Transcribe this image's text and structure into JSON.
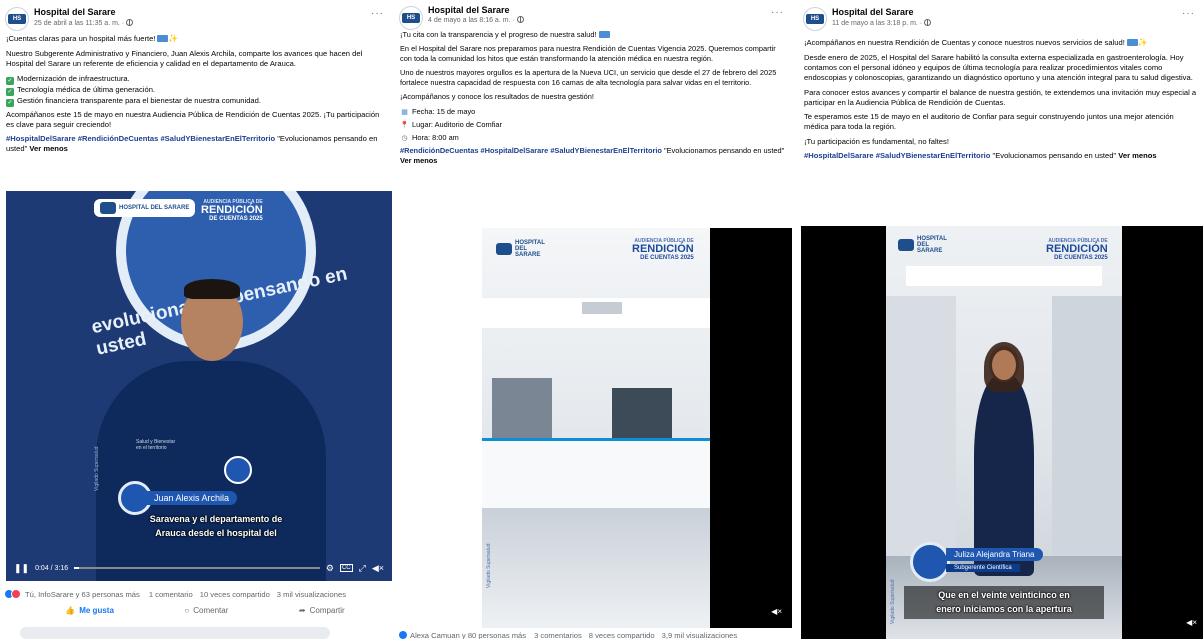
{
  "colors": {
    "link_blue": "#1d3f8f",
    "like_blue": "#1877f2",
    "meta_gray": "#65676b",
    "brand_blue": "#1f4e8c",
    "check_green": "#3aa55c"
  },
  "icons": [
    "globe-icon",
    "more-options-icon",
    "check-icon",
    "calendar-icon",
    "pin-icon",
    "clock-icon",
    "play-pause-icon",
    "settings-icon",
    "cc-icon",
    "expand-icon",
    "volume-icon",
    "like-icon",
    "comment-icon",
    "share-icon"
  ],
  "posts": [
    {
      "page_name": "Hospital del Sarare",
      "date": "25 de abril a las 11:35 a. m. ·",
      "text": {
        "intro": "¡Cuentas claras para un hospital más fuerte!",
        "p1": "Nuestro Subgerente Administrativo y Financiero, Juan Alexis Archila, comparte los avances que hacen del Hospital del Sarare un referente de eficiencia y calidad en el departamento de Arauca.",
        "bullets": [
          "Modernización de infraestructura.",
          "Tecnología médica de última generación.",
          "Gestión financiera transparente para el bienestar de nuestra comunidad."
        ],
        "p2": "Acompáñanos este 15 de mayo en nuestra Audiencia Pública de Rendición de Cuentas 2025. ¡Tu participación es clave para seguir creciendo!",
        "hashtags": "#HospitalDelSarare #RendiciónDeCuentas #SaludYBienestarEnElTerritorio",
        "tagline": " \"Evolucionamos pensando en usted\" ",
        "ver_menos": "Ver menos"
      },
      "video": {
        "bg_text": "evolucionamos pensando en usted",
        "logo_text": "HOSPITAL DEL SARARE",
        "wm_top": "AUDIENCIA PÚBLICA DE",
        "wm_main": "RENDICIÓN",
        "wm_sub": "DE CUENTAS 2025",
        "shirt_text": "Salud y Bienestar en el territorio",
        "name_plate": "Juan Alexis Archila",
        "subtitle_1": "Saravena y el departamento de",
        "subtitle_2": "Arauca desde el hospital del",
        "time": "0:04 / 3:16",
        "progress": 0.02,
        "side_text": "Vigilado Supersalud"
      },
      "stats": {
        "reactions": "Tú, InfoSarare y 63 personas más",
        "comments": "1 comentario",
        "shares": "10 veces compartido",
        "views": "3 mil visualizaciones"
      },
      "actions": {
        "like": "Me gusta",
        "comment": "Comentar",
        "share": "Compartir"
      }
    },
    {
      "page_name": "Hospital del Sarare",
      "date": "4 de mayo a las 8:16 a. m. ·",
      "text": {
        "intro": "¡Tu cita con la transparencia y el progreso de nuestra salud!",
        "p1": "En el Hospital del Sarare nos preparamos para nuestra Rendición de Cuentas Vigencia 2025. Queremos compartir con toda la comunidad los hitos que están transformando la atención médica en nuestra región.",
        "p2": "Uno de nuestros mayores orgullos es la apertura de la Nueva UCI, un servicio que desde el 27 de febrero del 2025 fortalece nuestra capacidad de respuesta con 16 camas de alta tecnología para salvar vidas en el territorio.",
        "p3": "¡Acompáñanos y conoce los resultados de nuestra gestión!",
        "fecha": "Fecha: 15 de mayo",
        "lugar": "Lugar: Auditorio de Comfiar",
        "hora": "Hora: 8:00 am",
        "hashtags": "#RendiciónDeCuentas #HospitalDelSarare #SaludYBienestarEnElTerritorio",
        "tagline": " \"Evolucionamos pensando en usted\" ",
        "ver_menos": "Ver menos"
      },
      "video": {
        "logo_text": "HOSPITAL DEL SARARE",
        "wm_top": "AUDIENCIA PÚBLICA DE",
        "wm_main": "RENDICIÓN",
        "wm_sub": "DE CUENTAS 2025",
        "side_text": "Vigilado Supersalud"
      },
      "stats": {
        "reactions": "Alexa Camuan y 80 personas más",
        "comments": "3 comentarios",
        "shares": "8 veces compartido",
        "views": "3,9 mil visualizaciones"
      }
    },
    {
      "page_name": "Hospital del Sarare",
      "date": "11 de mayo a las 3:18 p. m. ·",
      "text": {
        "intro": "¡Acompáñanos en nuestra Rendición de Cuentas y conoce nuestros nuevos servicios de salud!",
        "p1": "Desde enero de 2025, el Hospital del Sarare habilitó la consulta externa especializada en gastroenterología. Hoy contamos con el personal idóneo y equipos de última tecnología para realizar procedimientos vitales como endoscopias y colonoscopias, garantizando un diagnóstico oportuno y una atención integral para tu salud digestiva.",
        "p2": "Para conocer estos avances y compartir el balance de nuestra gestión, te extendemos una invitación muy especial a participar en la Audiencia Pública de Rendición de Cuentas.",
        "p3": "Te esperamos este 15 de mayo en el auditorio de Confiar para seguir construyendo juntos una mejor atención médica para toda la región.",
        "p4": "¡Tu participación es fundamental, no faltes!",
        "hashtags": "#HospitalDelSarare #SaludYBienestarEnElTerritorio",
        "tagline": " \"Evolucionamos pensando en usted\" ",
        "ver_menos": "Ver menos"
      },
      "video": {
        "logo_text": "HOSPITAL DEL SARARE",
        "wm_top": "AUDIENCIA PÚBLICA DE",
        "wm_main": "RENDICIÓN",
        "wm_sub": "DE CUENTAS 2025",
        "name_plate": "Juliza Alejandra Triana",
        "role_plate": "Subgerente Científica",
        "subtitle_1": "Que en el veinte veinticinco en",
        "subtitle_2": "enero iniciamos con la apertura",
        "side_text": "Vigilado Supersalud"
      }
    }
  ]
}
